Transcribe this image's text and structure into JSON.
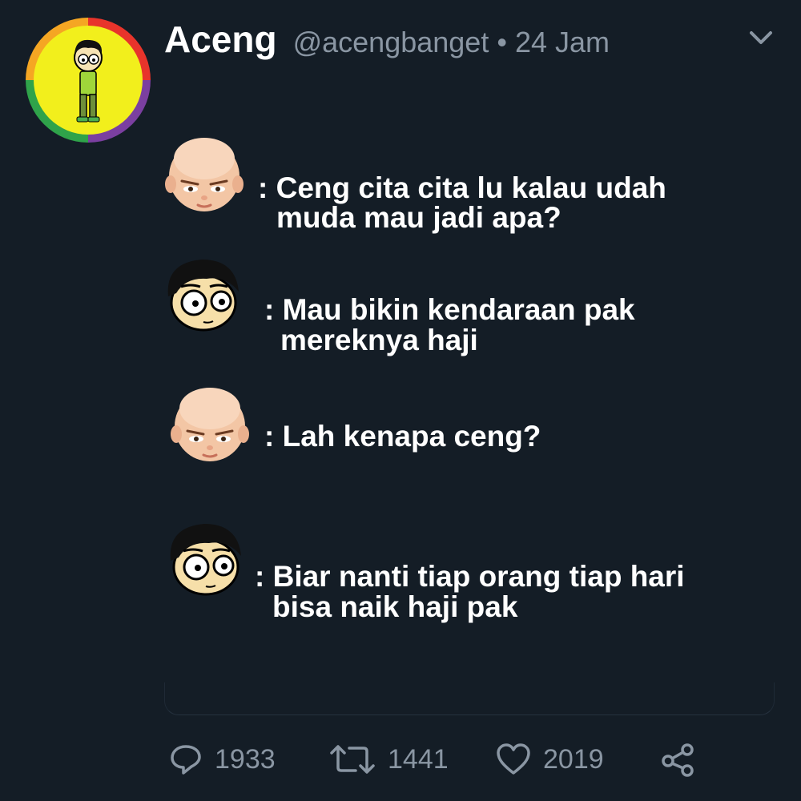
{
  "tweet": {
    "author": {
      "display_name": "Aceng",
      "handle": "@acengbanget",
      "separator": "•",
      "timestamp": "24 Jam"
    },
    "menu_icon": "chevron-down-icon",
    "conversation": [
      {
        "speaker": "boss-baby-face",
        "lines": [
          ": Ceng cita cita lu kalau udah",
          "muda mau jadi apa?"
        ]
      },
      {
        "speaker": "aceng-face",
        "lines": [
          ": Mau bikin kendaraan pak",
          "mereknya haji"
        ]
      },
      {
        "speaker": "boss-baby-face",
        "lines": [
          ": Lah kenapa ceng?"
        ]
      },
      {
        "speaker": "aceng-face",
        "lines": [
          ": Biar nanti tiap orang tiap hari",
          "bisa naik haji pak"
        ]
      }
    ],
    "actions": {
      "reply": {
        "icon": "reply-icon",
        "count": "1933"
      },
      "retweet": {
        "icon": "retweet-icon",
        "count": "1441"
      },
      "like": {
        "icon": "heart-icon",
        "count": "2019"
      },
      "share": {
        "icon": "share-icon"
      }
    },
    "colors": {
      "background": "#141d26",
      "text": "#ffffff",
      "muted": "#8a96a3"
    }
  }
}
